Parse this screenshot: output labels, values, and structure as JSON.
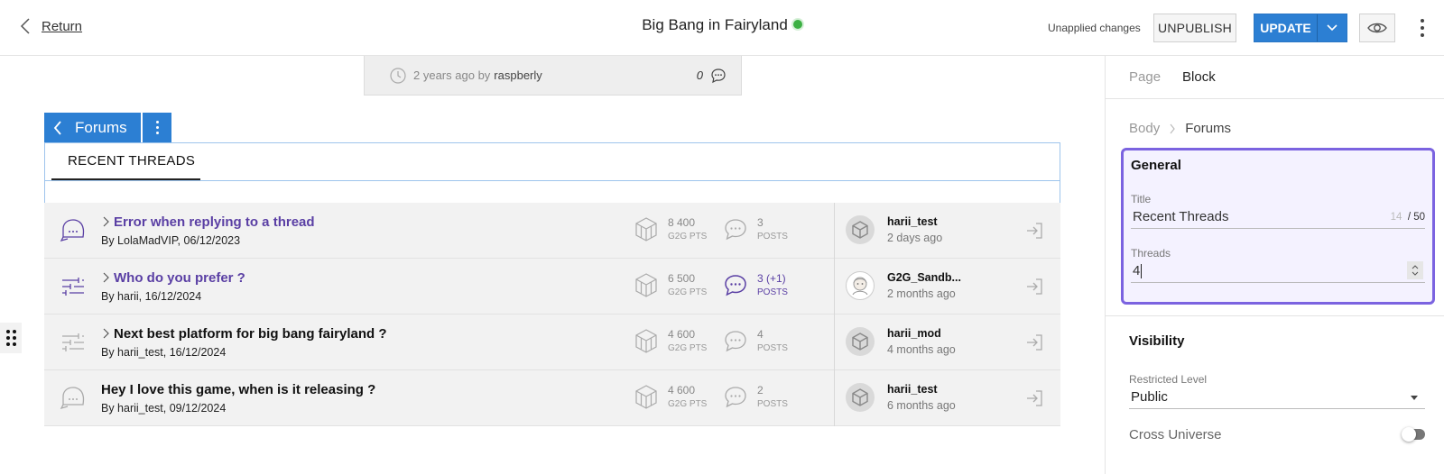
{
  "header": {
    "return_label": "Return",
    "title": "Big Bang in Fairyland",
    "status_color": "#3cb043",
    "unapplied_label": "Unapplied changes",
    "unpublish_label": "UNPUBLISH",
    "update_label": "UPDATE"
  },
  "previous_card": {
    "time": "2 years ago",
    "by_label": "by",
    "author": "raspberly",
    "comment_count": "0"
  },
  "block": {
    "tab_label": "Forums",
    "heading": "RECENT THREADS"
  },
  "threads": [
    {
      "title": "Error when replying to a thread",
      "byline": "By LolaMadVIP, 06/12/2023",
      "pts": "8 400",
      "pts_unit": "G2G PTS",
      "posts": "3",
      "posts_unit": "POSTS",
      "last_user": "harii_test",
      "last_time": "2 days ago"
    },
    {
      "title": "Who do you prefer ?",
      "byline": "By harii, 16/12/2024",
      "pts": "6 500",
      "pts_unit": "G2G PTS",
      "posts": "3 (+1)",
      "posts_unit": "POSTS",
      "last_user": "G2G_Sandb...",
      "last_time": "2 months ago"
    },
    {
      "title": "Next best platform for big bang fairyland ?",
      "byline": "By harii_test, 16/12/2024",
      "pts": "4 600",
      "pts_unit": "G2G PTS",
      "posts": "4",
      "posts_unit": "POSTS",
      "last_user": "harii_mod",
      "last_time": "4 months ago"
    },
    {
      "title": "Hey I love this game, when is it releasing ?",
      "byline": "By harii_test, 09/12/2024",
      "pts": "4 600",
      "pts_unit": "G2G PTS",
      "posts": "2",
      "posts_unit": "POSTS",
      "last_user": "harii_test",
      "last_time": "6 months ago"
    }
  ],
  "panel": {
    "tab_page": "Page",
    "tab_block": "Block",
    "crumb_root": "Body",
    "crumb_current": "Forums",
    "general_heading": "General",
    "title_label": "Title",
    "title_value": "Recent Threads",
    "title_count": "14",
    "title_max": "/ 50",
    "threads_label": "Threads",
    "threads_value": "4",
    "visibility_heading": "Visibility",
    "restricted_label": "Restricted Level",
    "restricted_value": "Public",
    "cross_universe_label": "Cross Universe"
  },
  "colors": {
    "accent": "#2c7fd3",
    "link": "#5a3fa4",
    "focus": "#7b63e0"
  }
}
